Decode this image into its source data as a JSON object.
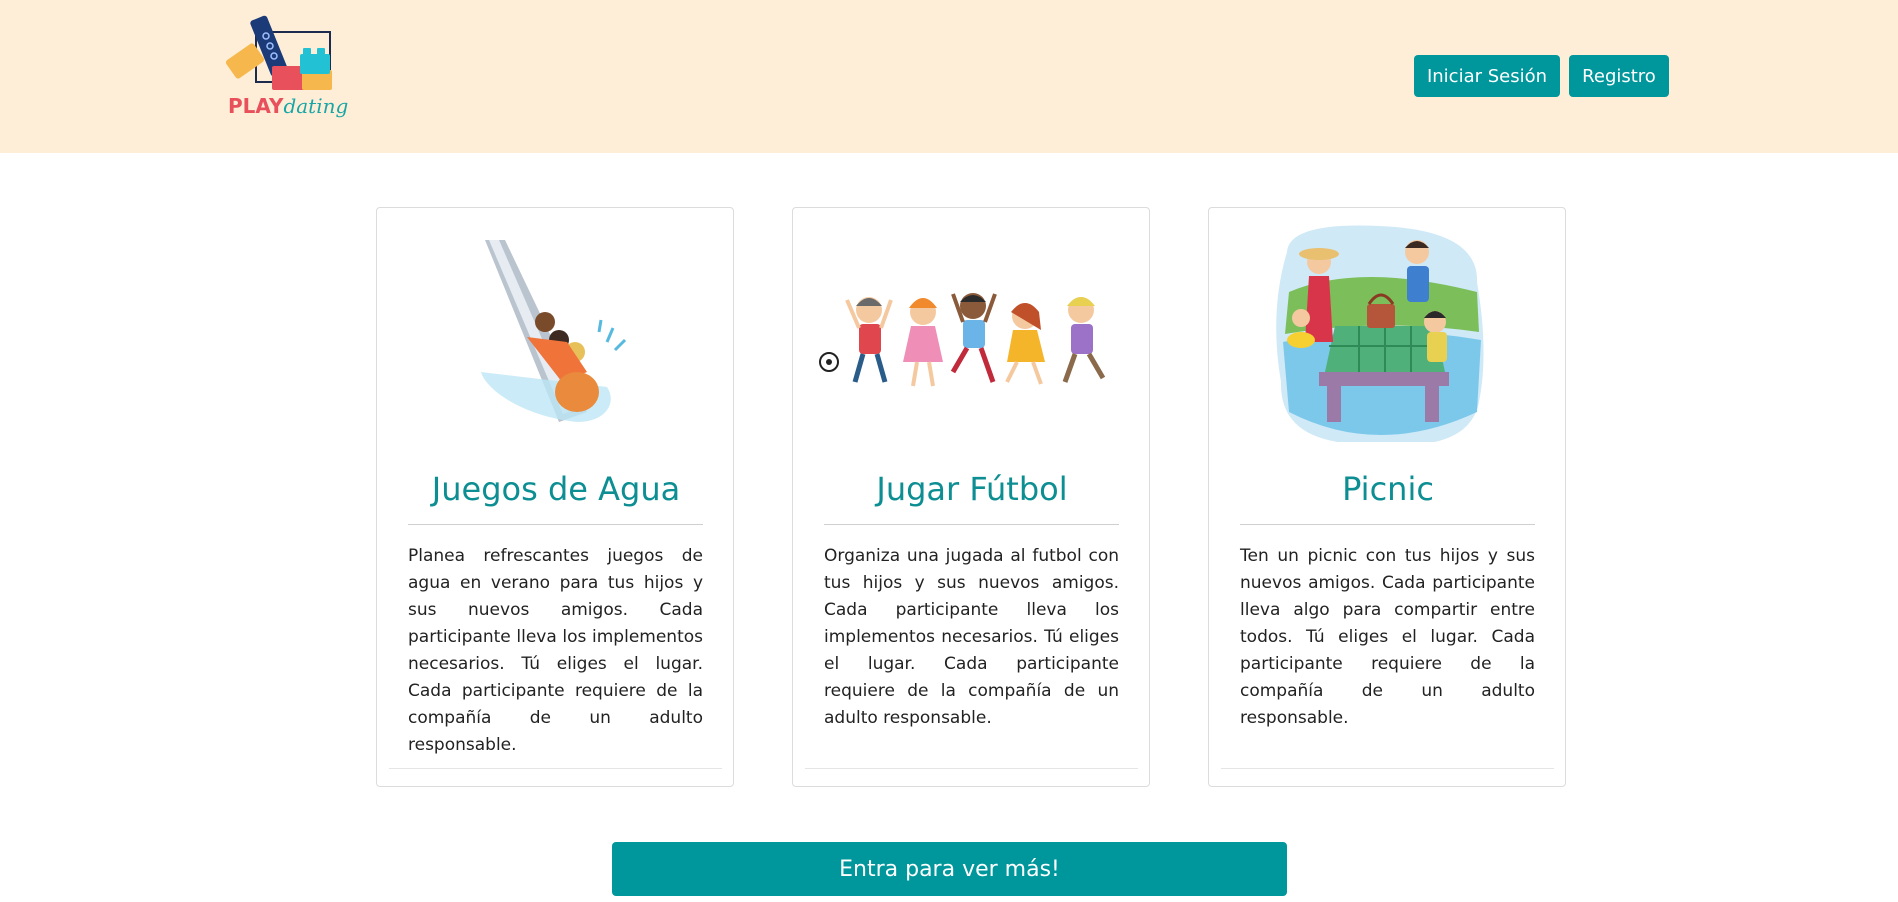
{
  "header": {
    "logo": {
      "play": "PLAY",
      "dating": "dating"
    },
    "login_label": "Iniciar Sesión",
    "register_label": "Registro"
  },
  "cards": [
    {
      "title": "Juegos de Agua",
      "text": "Planea refrescantes juegos de agua en verano para tus hijos y sus nuevos amigos. Cada participante lleva los implementos necesarios. Tú eliges el lugar. Cada participante requiere de la compañía de un adulto responsable.",
      "image": "water-slide-kids-illustration"
    },
    {
      "title": "Jugar Fútbol",
      "text": "Organiza una jugada al futbol con tus hijos y sus nuevos amigos. Cada participante lleva los implementos necesarios. Tú eliges el lugar. Cada participante requiere de la compañía de un adulto responsable.",
      "image": "kids-jumping-soccer-illustration"
    },
    {
      "title": "Picnic",
      "text": "Ten un picnic con tus hijos y sus nuevos amigos. Cada participante lleva algo para compartir entre todos. Tú eliges el lugar. Cada participante requiere de la compañía de un adulto responsable.",
      "image": "family-picnic-illustration"
    }
  ],
  "cta_label": "Entra para ver más!",
  "colors": {
    "header_bg": "#feeed8",
    "accent": "#00979c",
    "title": "#0d8e93"
  }
}
